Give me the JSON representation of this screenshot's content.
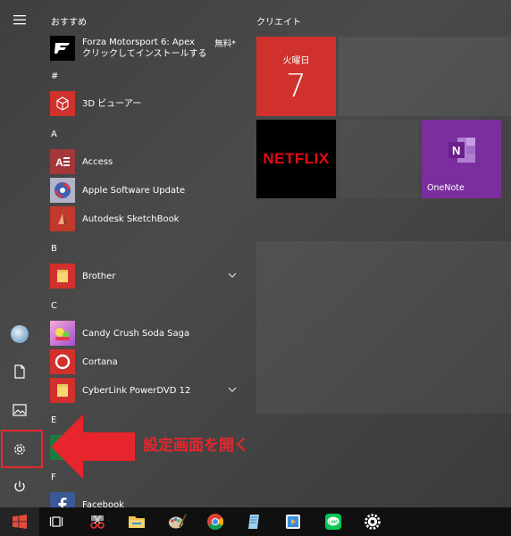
{
  "sections": {
    "recommended": "おすすめ",
    "hash": "#",
    "a": "A",
    "b": "B",
    "c": "C",
    "e": "E",
    "f": "F"
  },
  "apps": {
    "forza": {
      "title": "Forza Motorsport 6: Apex",
      "subtitle": "クリックしてインストールする",
      "badge": "無料*"
    },
    "viewer3d": "3D ビューアー",
    "access": "Access",
    "apple_update": "Apple Software Update",
    "sketchbook": "Autodesk SketchBook",
    "brother": "Brother",
    "candy": "Candy Crush Soda Saga",
    "cortana": "Cortana",
    "cyberlink": "CyberLink PowerDVD 12",
    "facebook": "Facebook"
  },
  "tiles": {
    "group_title": "クリエイト",
    "calendar_dow": "火曜日",
    "calendar_day": "7",
    "netflix": "NETFLIX",
    "onenote": "OneNote"
  },
  "annotation": {
    "caption": "設定画面を開く",
    "color": "#e8252d"
  },
  "colors": {
    "calendar": "#d0312d",
    "onenote": "#7b2f9e",
    "netflix": "#e50914",
    "taskbar": "#101010"
  },
  "taskbar_icons": [
    "windows-start-icon",
    "task-view-icon",
    "snipping-tool-icon",
    "file-explorer-icon",
    "paint-icon",
    "chrome-icon",
    "notepad-icon",
    "media-player-icon",
    "line-icon",
    "settings-gear-icon"
  ]
}
